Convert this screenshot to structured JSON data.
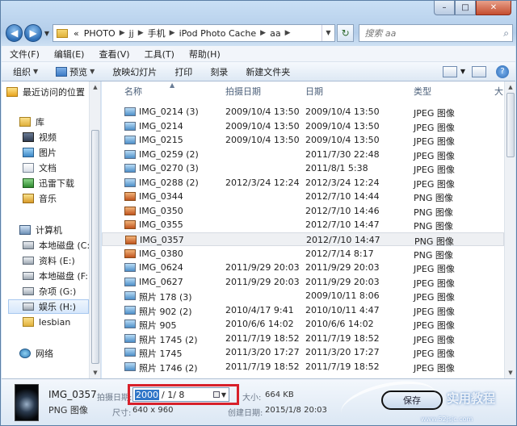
{
  "window": {
    "caption_min": "–",
    "caption_max": "□",
    "caption_close": "✕"
  },
  "address": {
    "prefix": "«",
    "crumbs": [
      "PHOTO",
      "jj",
      "手机",
      "iPod Photo Cache",
      "aa"
    ],
    "search_placeholder": "搜索 aa"
  },
  "menubar": [
    "文件(F)",
    "编辑(E)",
    "查看(V)",
    "工具(T)",
    "帮助(H)"
  ],
  "toolbar": {
    "organize": "组织",
    "preview": "预览",
    "slideshow": "放映幻灯片",
    "print": "打印",
    "burn": "刻录",
    "new_folder": "新建文件夹",
    "help": "?"
  },
  "nav": {
    "recent": "最近访问的位置",
    "libraries": "库",
    "video": "视频",
    "pictures": "图片",
    "docs": "文档",
    "thunder": "迅雷下载",
    "music": "音乐",
    "computer": "计算机",
    "drives": [
      "本地磁盘 (C:)",
      "资料 (E:)",
      "本地磁盘 (F:)",
      "杂项 (G:)",
      "娱乐 (H:)"
    ],
    "lesbian": "lesbian",
    "network": "网络"
  },
  "columns": {
    "name": "名称",
    "taken": "拍摄日期",
    "date": "日期",
    "type": "类型",
    "more": "大"
  },
  "files": [
    {
      "name": "IMG_0214 (3)",
      "taken": "2009/10/4 13:50",
      "date": "2009/10/4 13:50",
      "type": "JPEG 图像",
      "kind": "jpeg"
    },
    {
      "name": "IMG_0214",
      "taken": "2009/10/4 13:50",
      "date": "2009/10/4 13:50",
      "type": "JPEG 图像",
      "kind": "jpeg"
    },
    {
      "name": "IMG_0215",
      "taken": "2009/10/4 13:50",
      "date": "2009/10/4 13:50",
      "type": "JPEG 图像",
      "kind": "jpeg"
    },
    {
      "name": "IMG_0259 (2)",
      "taken": "",
      "date": "2011/7/30 22:48",
      "type": "JPEG 图像",
      "kind": "jpeg"
    },
    {
      "name": "IMG_0270 (3)",
      "taken": "",
      "date": "2011/8/1 5:38",
      "type": "JPEG 图像",
      "kind": "jpeg"
    },
    {
      "name": "IMG_0288 (2)",
      "taken": "2012/3/24 12:24",
      "date": "2012/3/24 12:24",
      "type": "JPEG 图像",
      "kind": "jpeg"
    },
    {
      "name": "IMG_0344",
      "taken": "",
      "date": "2012/7/10 14:44",
      "type": "PNG 图像",
      "kind": "png"
    },
    {
      "name": "IMG_0350",
      "taken": "",
      "date": "2012/7/10 14:46",
      "type": "PNG 图像",
      "kind": "png"
    },
    {
      "name": "IMG_0355",
      "taken": "",
      "date": "2012/7/10 14:47",
      "type": "PNG 图像",
      "kind": "png"
    },
    {
      "name": "IMG_0357",
      "taken": "",
      "date": "2012/7/10 14:47",
      "type": "PNG 图像",
      "kind": "png"
    },
    {
      "name": "IMG_0380",
      "taken": "",
      "date": "2012/7/14 8:17",
      "type": "PNG 图像",
      "kind": "png"
    },
    {
      "name": "IMG_0624",
      "taken": "2011/9/29 20:03",
      "date": "2011/9/29 20:03",
      "type": "JPEG 图像",
      "kind": "jpeg"
    },
    {
      "name": "IMG_0627",
      "taken": "2011/9/29 20:03",
      "date": "2011/9/29 20:03",
      "type": "JPEG 图像",
      "kind": "jpeg"
    },
    {
      "name": "照片 178 (3)",
      "taken": "",
      "date": "2009/10/11 8:06",
      "type": "JPEG 图像",
      "kind": "jpeg"
    },
    {
      "name": "照片 902 (2)",
      "taken": "2010/4/17 9:41",
      "date": "2010/10/11 4:47",
      "type": "JPEG 图像",
      "kind": "jpeg"
    },
    {
      "name": "照片 905",
      "taken": "2010/6/6 14:02",
      "date": "2010/6/6 14:02",
      "type": "JPEG 图像",
      "kind": "jpeg"
    },
    {
      "name": "照片 1745 (2)",
      "taken": "2011/7/19 18:52",
      "date": "2011/7/19 18:52",
      "type": "JPEG 图像",
      "kind": "jpeg"
    },
    {
      "name": "照片 1745",
      "taken": "2011/3/20 17:27",
      "date": "2011/3/20 17:27",
      "type": "JPEG 图像",
      "kind": "jpeg"
    },
    {
      "name": "照片 1746 (2)",
      "taken": "2011/7/19 18:52",
      "date": "2011/7/19 18:52",
      "type": "JPEG 图像",
      "kind": "jpeg"
    }
  ],
  "details": {
    "name": "IMG_0357",
    "type": "PNG 图像",
    "taken_label": "拍摄日期:",
    "date_year": "2000",
    "date_rest": "/  1/  8",
    "size_label": "尺寸:",
    "size_value": "640 x 960",
    "filesize_label": "大小:",
    "filesize_value": "664 KB",
    "created_label": "创建日期:",
    "created_value": "2015/1/8 20:03",
    "save": "保存"
  },
  "watermark": {
    "text": "实用教程",
    "url": "www.52jsjc.com"
  }
}
